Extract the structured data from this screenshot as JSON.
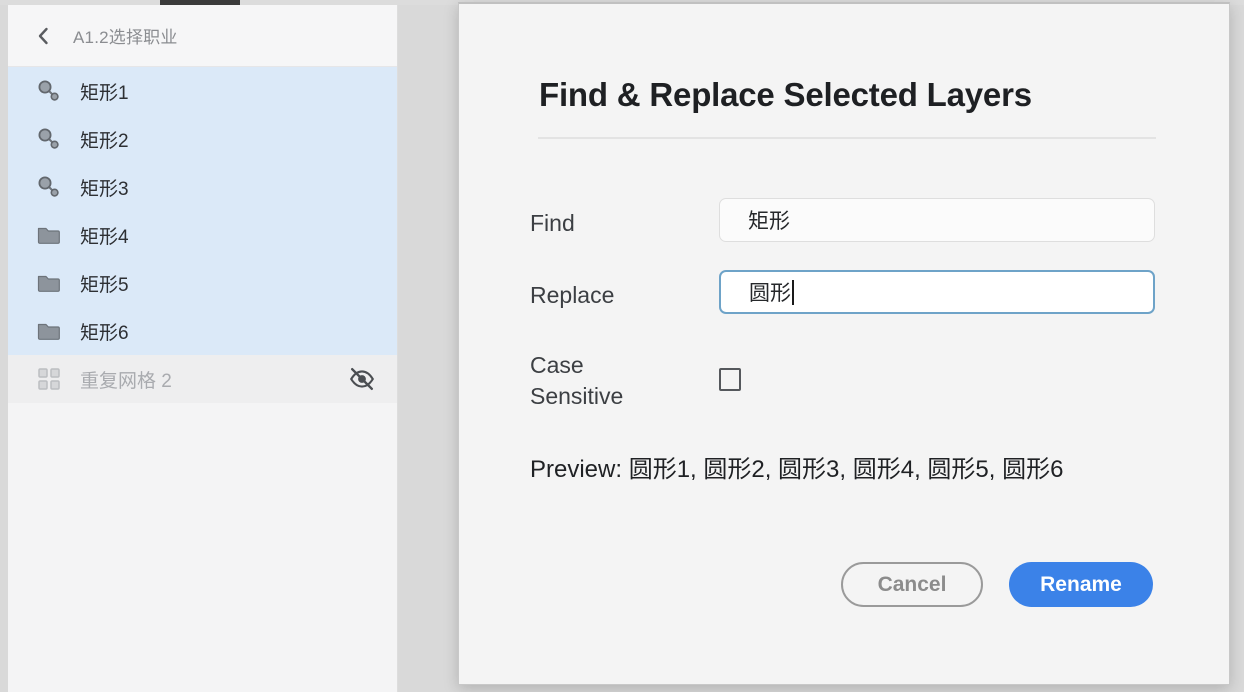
{
  "app": {
    "background_color": "#d9d9d9",
    "accent_color": "#3b82e8",
    "selection_color": "#dbe9f8"
  },
  "layers_panel": {
    "back_icon": "chevron-left-icon",
    "title": "A1.2选择职业",
    "rows": [
      {
        "icon": "component-icon",
        "label": "矩形1",
        "selected": true,
        "dimmed": false,
        "trailing_icon": ""
      },
      {
        "icon": "component-icon",
        "label": "矩形2",
        "selected": true,
        "dimmed": false,
        "trailing_icon": ""
      },
      {
        "icon": "component-icon",
        "label": "矩形3",
        "selected": true,
        "dimmed": false,
        "trailing_icon": ""
      },
      {
        "icon": "folder-icon",
        "label": "矩形4",
        "selected": true,
        "dimmed": false,
        "trailing_icon": ""
      },
      {
        "icon": "folder-icon",
        "label": "矩形5",
        "selected": true,
        "dimmed": false,
        "trailing_icon": ""
      },
      {
        "icon": "folder-icon",
        "label": "矩形6",
        "selected": true,
        "dimmed": false,
        "trailing_icon": ""
      },
      {
        "icon": "grid-icon",
        "label": "重复网格 2",
        "selected": false,
        "dimmed": true,
        "trailing_icon": "eye-off-icon"
      }
    ]
  },
  "dialog": {
    "title": "Find & Replace Selected Layers",
    "fields": {
      "find": {
        "label": "Find",
        "value": "矩形",
        "placeholder": "",
        "focused": false
      },
      "replace": {
        "label": "Replace",
        "value": "圆形",
        "placeholder": "",
        "focused": true
      },
      "case_sensitive": {
        "label": "Case Sensitive",
        "checked": false
      }
    },
    "preview": "Preview: 圆形1, 圆形2, 圆形3, 圆形4, 圆形5, 圆形6",
    "buttons": {
      "cancel": "Cancel",
      "rename": "Rename"
    }
  }
}
